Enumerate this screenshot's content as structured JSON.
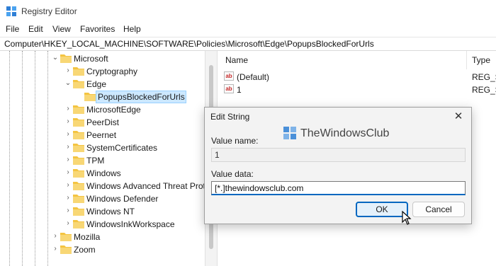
{
  "window": {
    "title": "Registry Editor",
    "icon": "registry-editor-icon"
  },
  "menu": [
    "File",
    "Edit",
    "View",
    "Favorites",
    "Help"
  ],
  "address": "Computer\\HKEY_LOCAL_MACHINE\\SOFTWARE\\Policies\\Microsoft\\Edge\\PopupsBlockedForUrls",
  "tree": {
    "items": [
      {
        "label": "Microsoft",
        "expanded": true
      },
      {
        "label": "Cryptography",
        "expanded": false
      },
      {
        "label": "Edge",
        "expanded": true
      },
      {
        "label": "PopupsBlockedForUrls",
        "selected": true
      },
      {
        "label": "MicrosoftEdge",
        "expanded": false
      },
      {
        "label": "PeerDist",
        "expanded": false
      },
      {
        "label": "Peernet",
        "expanded": false
      },
      {
        "label": "SystemCertificates",
        "expanded": false
      },
      {
        "label": "TPM",
        "expanded": false
      },
      {
        "label": "Windows",
        "expanded": false
      },
      {
        "label": "Windows Advanced Threat Prot",
        "expanded": false
      },
      {
        "label": "Windows Defender",
        "expanded": false
      },
      {
        "label": "Windows NT",
        "expanded": false
      },
      {
        "label": "WindowsInkWorkspace",
        "expanded": false
      },
      {
        "label": "Mozilla",
        "expanded": false
      },
      {
        "label": "Zoom",
        "expanded": false
      }
    ]
  },
  "values": {
    "columns": {
      "name": "Name",
      "type": "Type"
    },
    "rows": [
      {
        "name": "(Default)",
        "type": "REG_SZ",
        "icon_text": "ab"
      },
      {
        "name": "1",
        "type": "REG_SZ",
        "icon_text": "ab"
      }
    ]
  },
  "dialog": {
    "title": "Edit String",
    "close_glyph": "✕",
    "value_name_label": "Value name:",
    "value_name": "1",
    "value_data_label": "Value data:",
    "value_data": "[*.]thewindowsclub.com",
    "ok_label": "OK",
    "cancel_label": "Cancel"
  },
  "watermark": {
    "text": "TheWindowsClub"
  },
  "colors": {
    "accent": "#0067c0",
    "folder": "#f4c441",
    "selection": "#cce8ff"
  }
}
